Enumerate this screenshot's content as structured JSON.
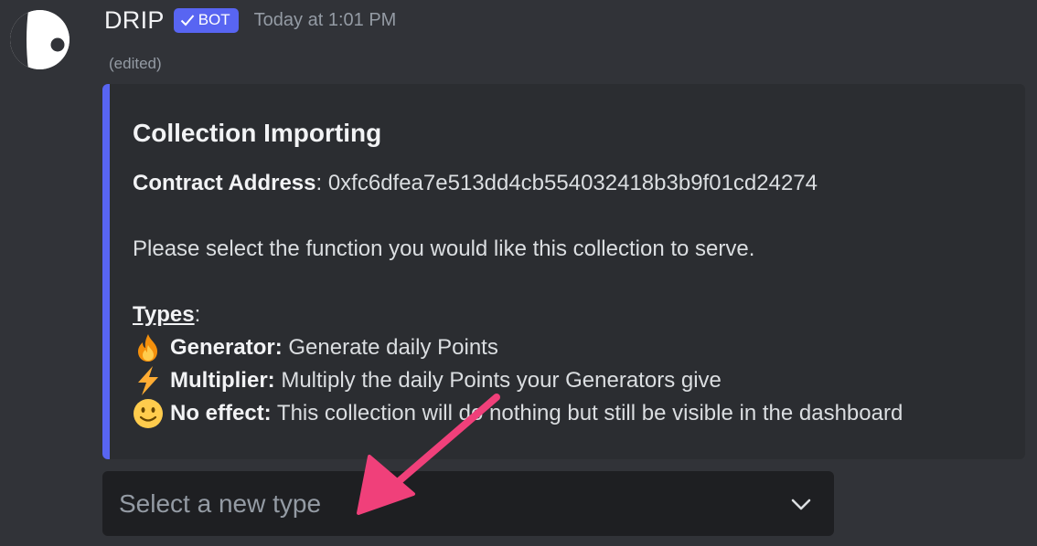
{
  "message": {
    "username": "DRIP",
    "bot_tag": "BOT",
    "timestamp": "Today at 1:01 PM",
    "edited": "(edited)"
  },
  "embed": {
    "accent_color": "#5865f2",
    "title": "Collection Importing",
    "contract_label": "Contract Address",
    "contract_sep": ":",
    "contract_value": " 0xfc6dfea7e513dd4cb554032418b3b9f01cd24274",
    "prompt": "Please select the function you would like this collection to serve.",
    "types_heading": "Types",
    "types_colon": ":",
    "types": [
      {
        "icon": "fire-icon",
        "label": "Generator:",
        "description": " Generate daily Points"
      },
      {
        "icon": "lightning-icon",
        "label": "Multiplier:",
        "description": " Multiply the daily Points your Generators give"
      },
      {
        "icon": "smiley-icon",
        "label": "No effect:",
        "description": " This collection will do nothing but still be visible in the dashboard"
      }
    ]
  },
  "select_menu": {
    "placeholder": "Select a new type",
    "icon": "chevron-down-icon"
  },
  "annotation": {
    "arrow_color": "#f0407a",
    "icon": "pointer-arrow-icon"
  }
}
